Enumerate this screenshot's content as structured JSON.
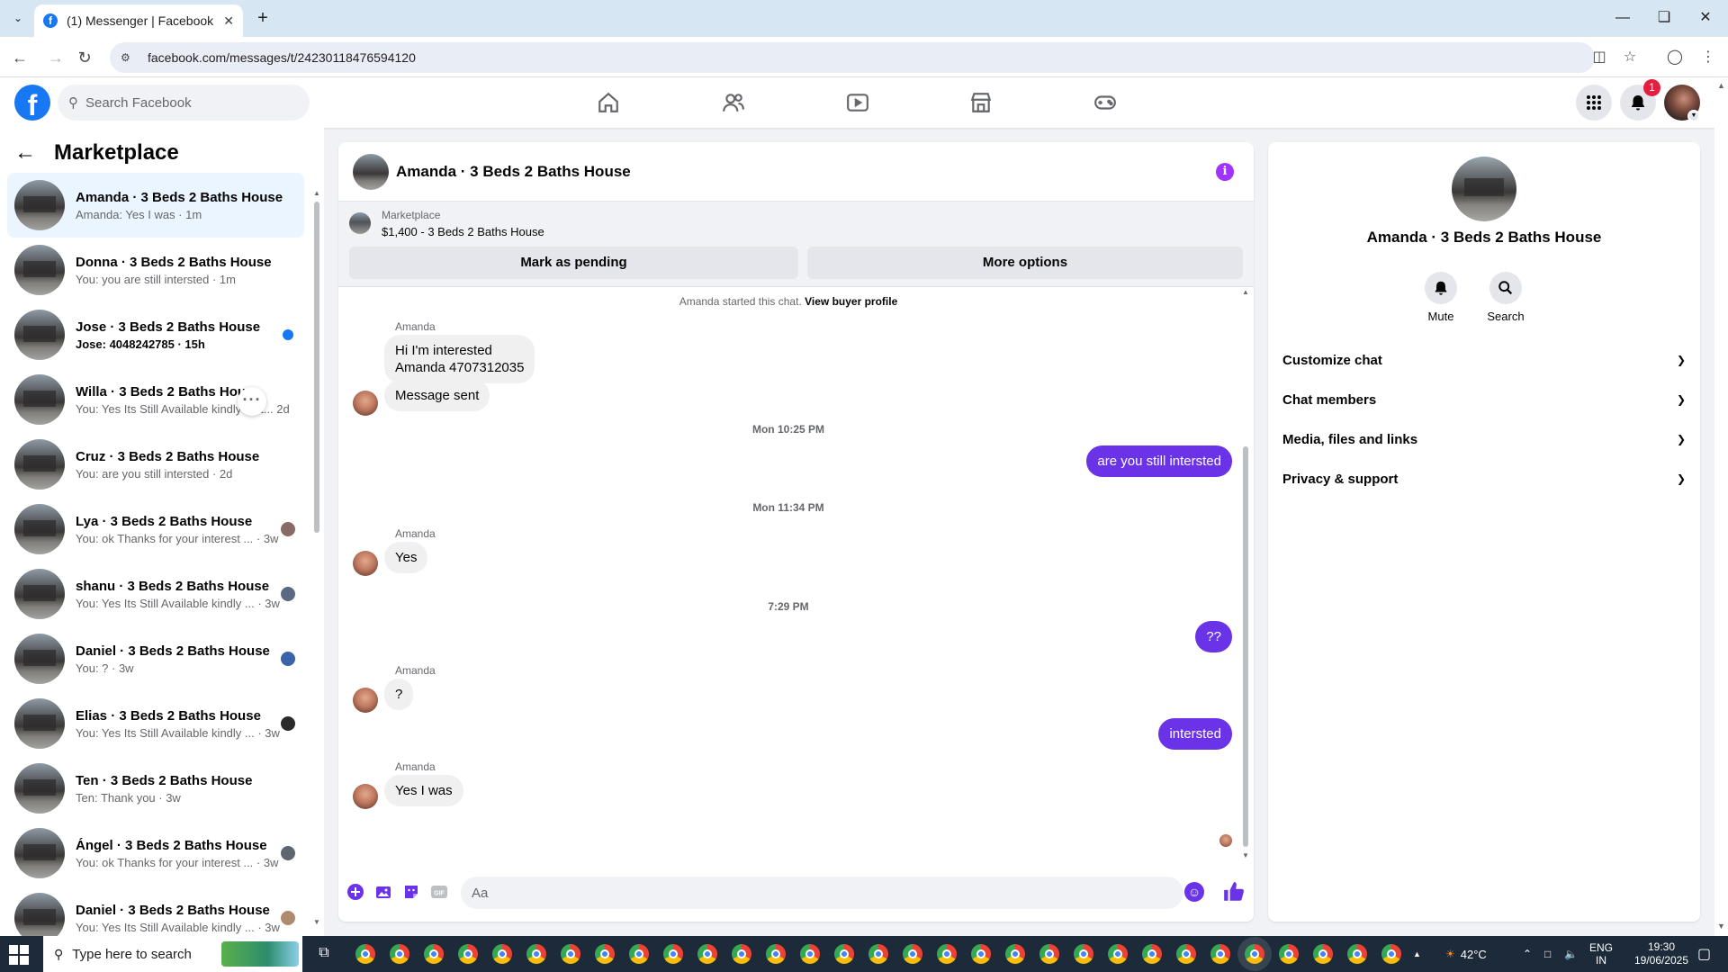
{
  "browser": {
    "tab_title": "(1) Messenger | Facebook",
    "url": "facebook.com/messages/t/24230118476594120"
  },
  "fb": {
    "search_placeholder": "Search Facebook",
    "notification_count": "1",
    "nav_icons": [
      "home-icon",
      "friends-icon",
      "video-icon",
      "marketplace-icon",
      "gaming-icon"
    ]
  },
  "sidebar": {
    "title": "Marketplace",
    "conversations": [
      {
        "name": "Amanda · 3 Beds 2 Baths House",
        "preview": "Amanda: Yes I was · 1m"
      },
      {
        "name": "Donna · 3 Beds 2 Baths House",
        "preview": "You: you are still intersted · 1m"
      },
      {
        "name": "Jose · 3 Beds 2 Baths House",
        "preview": "Jose: 4048242785 · 15h"
      },
      {
        "name": "Willa · 3 Beds 2 Baths House",
        "preview": "You: Yes Its Still Available kindly text... 2d"
      },
      {
        "name": "Cruz · 3 Beds 2 Baths House",
        "preview": "You: are you still intersted · 2d"
      },
      {
        "name": "Lya · 3 Beds 2 Baths House",
        "preview": "You: ok Thanks for your interest ... · 3w"
      },
      {
        "name": "shanu · 3 Beds 2 Baths House",
        "preview": "You: Yes Its Still Available kindly ... · 3w"
      },
      {
        "name": "Daniel · 3 Beds 2 Baths House",
        "preview": "You: ? · 3w"
      },
      {
        "name": "Elias · 3 Beds 2 Baths House",
        "preview": "You: Yes Its Still Available kindly ... · 3w"
      },
      {
        "name": "Ten · 3 Beds 2 Baths House",
        "preview": "Ten: Thank you · 3w"
      },
      {
        "name": "Ángel · 3 Beds 2 Baths House",
        "preview": "You: ok Thanks for your interest ... · 3w"
      },
      {
        "name": "Daniel · 3 Beds 2 Baths House",
        "preview": "You: Yes Its Still Available kindly ... · 3w"
      }
    ]
  },
  "chat": {
    "title": "Amanda · 3 Beds 2 Baths House",
    "marketplace_label": "Marketplace",
    "listing": "$1,400 - 3 Beds 2 Baths House",
    "mark_pending": "Mark as pending",
    "more_options": "More options",
    "started_text": "Amanda started this chat.",
    "view_profile": "View buyer profile",
    "sender_name": "Amanda",
    "msg1_line1": "Hi I'm interested",
    "msg1_line2": "Amanda 4707312035",
    "msg2": "Message sent",
    "time1": "Mon 10:25 PM",
    "out1": "are you still intersted",
    "time2": "Mon 11:34 PM",
    "msg3": "Yes",
    "time3": "7:29 PM",
    "out2": "??",
    "msg4": "?",
    "out3": "intersted",
    "msg5": "Yes I was",
    "composer_placeholder": "Aa"
  },
  "details": {
    "name": "Amanda · 3 Beds 2 Baths House",
    "mute": "Mute",
    "search": "Search",
    "rows": [
      "Customize chat",
      "Chat members",
      "Media, files and links",
      "Privacy & support"
    ]
  },
  "taskbar": {
    "search_placeholder": "Type here to search",
    "temperature": "42°C",
    "lang1": "ENG",
    "lang2": "IN",
    "time": "19:30",
    "date": "19/06/2025"
  },
  "colors": {
    "facebook_blue": "#1877f2",
    "outgoing_bubble": "#6a33e8",
    "active_row": "#ebf5ff"
  }
}
